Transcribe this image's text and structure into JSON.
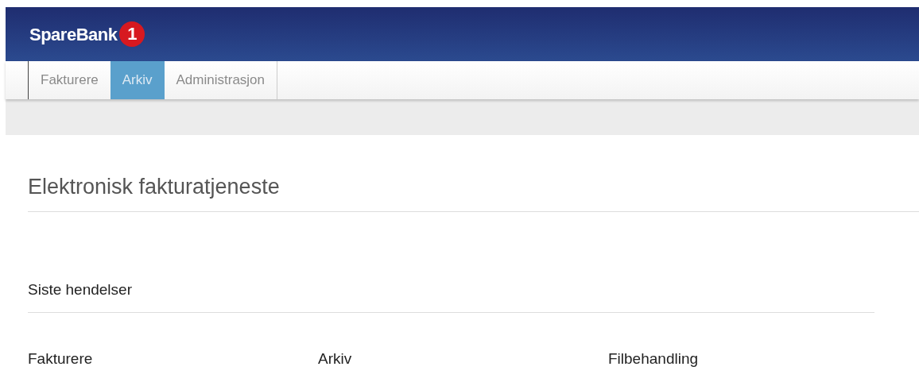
{
  "header": {
    "logo_text": "SpareBank",
    "logo_badge": "1"
  },
  "tabs": [
    {
      "label": "Fakturere",
      "selected": false
    },
    {
      "label": "Arkiv",
      "selected": true
    },
    {
      "label": "Administrasjon",
      "selected": false
    }
  ],
  "page_title": "Elektronisk fakturatjeneste",
  "section_title": "Siste hendelser",
  "columns": [
    "Fakturere",
    "Arkiv",
    "Filbehandling"
  ]
}
